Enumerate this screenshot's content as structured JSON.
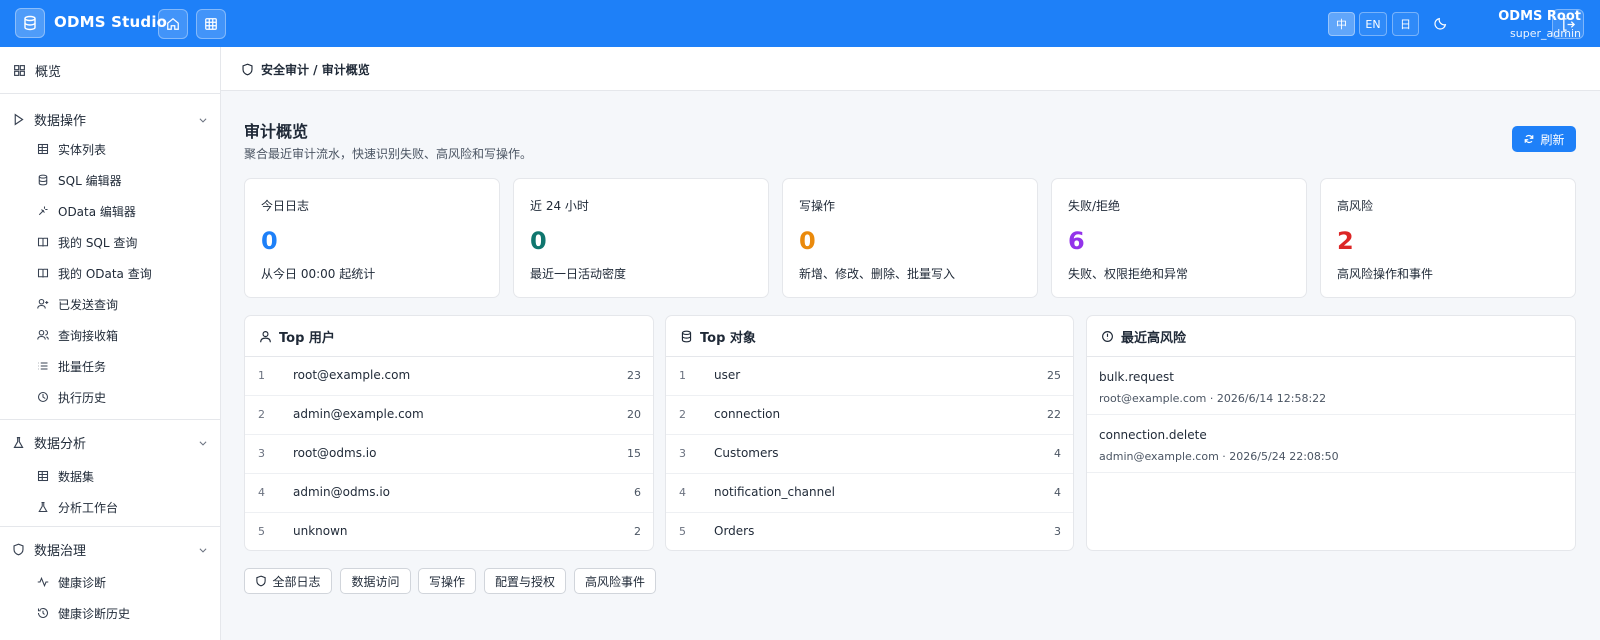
{
  "app": {
    "title": "ODMS Studio"
  },
  "languages": [
    "中",
    "EN",
    "日"
  ],
  "user": {
    "name": "ODMS Root",
    "role": "super_admin"
  },
  "sidebar": {
    "overview": "概览",
    "groups": [
      {
        "label": "数据操作",
        "items": [
          "实体列表",
          "SQL 编辑器",
          "OData 编辑器",
          "我的 SQL 查询",
          "我的 OData 查询",
          "已发送查询",
          "查询接收箱",
          "批量任务",
          "执行历史"
        ]
      },
      {
        "label": "数据分析",
        "items": [
          "数据集",
          "分析工作台"
        ]
      },
      {
        "label": "数据治理",
        "items": [
          "健康诊断",
          "健康诊断历史"
        ]
      }
    ]
  },
  "breadcrumb": "安全审计 / 审计概览",
  "page": {
    "title": "审计概览",
    "subtitle": "聚合最近审计流水，快速识别失败、高风险和写操作。",
    "refresh": "刷新"
  },
  "stats": [
    {
      "label": "今日日志",
      "value": "0",
      "desc": "从今日 00:00 起统计",
      "color": "#1e80f8"
    },
    {
      "label": "近 24 小时",
      "value": "0",
      "desc": "最近一日活动密度",
      "color": "#0f766e"
    },
    {
      "label": "写操作",
      "value": "0",
      "desc": "新增、修改、删除、批量写入",
      "color": "#ea8a0c"
    },
    {
      "label": "失败/拒绝",
      "value": "6",
      "desc": "失败、权限拒绝和异常",
      "color": "#9333ea"
    },
    {
      "label": "高风险",
      "value": "2",
      "desc": "高风险操作和事件",
      "color": "#dc2626"
    }
  ],
  "top_users": {
    "title": "Top 用户",
    "rows": [
      {
        "rank": "1",
        "name": "root@example.com",
        "count": "23"
      },
      {
        "rank": "2",
        "name": "admin@example.com",
        "count": "20"
      },
      {
        "rank": "3",
        "name": "root@odms.io",
        "count": "15"
      },
      {
        "rank": "4",
        "name": "admin@odms.io",
        "count": "6"
      },
      {
        "rank": "5",
        "name": "unknown",
        "count": "2"
      }
    ]
  },
  "top_objects": {
    "title": "Top 对象",
    "rows": [
      {
        "rank": "1",
        "name": "user",
        "count": "25"
      },
      {
        "rank": "2",
        "name": "connection",
        "count": "22"
      },
      {
        "rank": "3",
        "name": "Customers",
        "count": "4"
      },
      {
        "rank": "4",
        "name": "notification_channel",
        "count": "4"
      },
      {
        "rank": "5",
        "name": "Orders",
        "count": "3"
      }
    ]
  },
  "recent_risk": {
    "title": "最近高风险",
    "items": [
      {
        "title": "bulk.request",
        "meta": "root@example.com · 2026/6/14 12:58:22"
      },
      {
        "title": "connection.delete",
        "meta": "admin@example.com · 2026/5/24 22:08:50"
      }
    ]
  },
  "filters": [
    "全部日志",
    "数据访问",
    "写操作",
    "配置与授权",
    "高风险事件"
  ]
}
